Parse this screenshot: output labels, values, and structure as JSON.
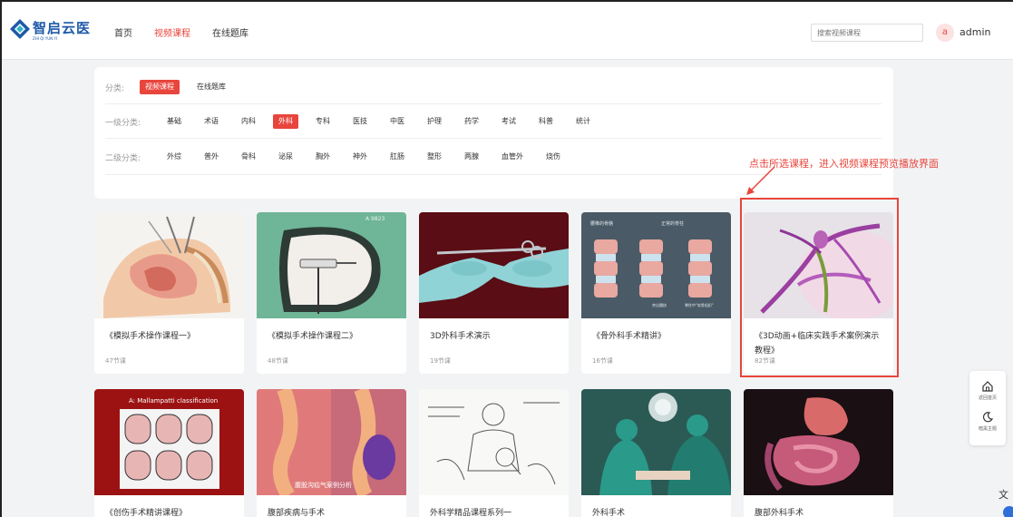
{
  "header": {
    "logo_text": "智启云医",
    "logo_sub": "ZHI QI YUN YI",
    "nav": [
      "首页",
      "视频课程",
      "在线题库"
    ],
    "active_nav": 1,
    "search_placeholder": "搜索视频课程",
    "avatar_letter": "a",
    "username": "admin"
  },
  "filters": {
    "category_label": "分类:",
    "categories": [
      "视频课程",
      "在线题库"
    ],
    "level1_label": "一级分类:",
    "level1": [
      "基础",
      "术语",
      "内科",
      "外科",
      "专科",
      "医技",
      "中医",
      "护理",
      "药学",
      "考试",
      "科普",
      "统计"
    ],
    "level2_label": "二级分类:",
    "level2": [
      "外综",
      "普外",
      "骨科",
      "泌尿",
      "胸外",
      "神外",
      "肛肠",
      "整形",
      "两腺",
      "血管外",
      "烧伤"
    ]
  },
  "annotation": "点击所选课程，进入视频课程预览播放界面",
  "courses": [
    {
      "title": "《模拟手术操作课程一》",
      "lessons": "47节课"
    },
    {
      "title": "《模拟手术操作课程二》",
      "lessons": "48节课"
    },
    {
      "title": "3D外科手术演示",
      "lessons": "19节课"
    },
    {
      "title": "《骨外科手术精讲》",
      "lessons": "16节课"
    },
    {
      "title": "《3D动画+临床实践手术案例演示教程》",
      "lessons": "82节课"
    },
    {
      "title": "《创伤手术精讲课程》",
      "lessons": ""
    },
    {
      "title": "腹部疾病与手术",
      "lessons": ""
    },
    {
      "title": "外科学精品课程系列一",
      "lessons": ""
    },
    {
      "title": "外科手术",
      "lessons": ""
    },
    {
      "title": "腹部外科手术",
      "lessons": ""
    }
  ],
  "thumb_texts": {
    "thumb1_tag": "A 9823",
    "thumb3_left": "腰椎的骨骼",
    "thumb3_right": "正常的脊柱",
    "thumb3_bottom_left": "突出髓核",
    "thumb3_bottom_right": "脊柱中\"软骨组织\"",
    "thumb5_title": "A: Mallampatti classification",
    "thumb6_caption": "腹股沟疝气案例分析"
  },
  "float_sidebar": {
    "home_label": "返回首页",
    "theme_label": "暗黑主题"
  },
  "colors": {
    "accent": "#e8453c",
    "brand": "#1e5aa8"
  }
}
